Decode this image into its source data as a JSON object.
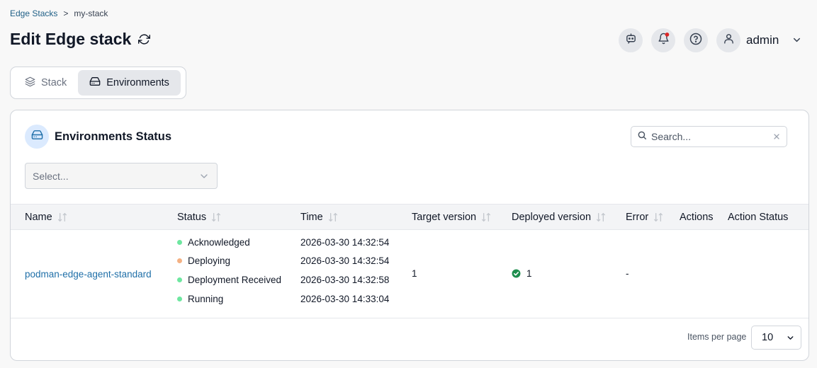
{
  "breadcrumb": {
    "parent": "Edge Stacks",
    "separator": ">",
    "current": "my-stack"
  },
  "page": {
    "title": "Edit Edge stack"
  },
  "header": {
    "username": "admin"
  },
  "tabs": [
    {
      "label": "Stack",
      "active": false
    },
    {
      "label": "Environments",
      "active": true
    }
  ],
  "card": {
    "title": "Environments Status",
    "search_placeholder": "Search...",
    "filter_placeholder": "Select..."
  },
  "table": {
    "columns": [
      "Name",
      "Status",
      "Time",
      "Target version",
      "Deployed version",
      "Error",
      "Actions",
      "Action Status"
    ],
    "rows": [
      {
        "name": "podman-edge-agent-standard",
        "statuses": [
          {
            "label": "Acknowledged",
            "color": "#6ee7a0",
            "time": "2026-03-30 14:32:54"
          },
          {
            "label": "Deploying",
            "color": "#f4b183",
            "time": "2026-03-30 14:32:54"
          },
          {
            "label": "Deployment Received",
            "color": "#6ee7a0",
            "time": "2026-03-30 14:32:58"
          },
          {
            "label": "Running",
            "color": "#6ee7a0",
            "time": "2026-03-30 14:33:04"
          }
        ],
        "target_version": "1",
        "deployed_version": "1",
        "error": "-"
      }
    ]
  },
  "pagination": {
    "label": "Items per page",
    "value": "10"
  },
  "colors": {
    "accent_link": "#1f6fa8",
    "success": "#1e8e4e",
    "notification": "#dc2626"
  }
}
